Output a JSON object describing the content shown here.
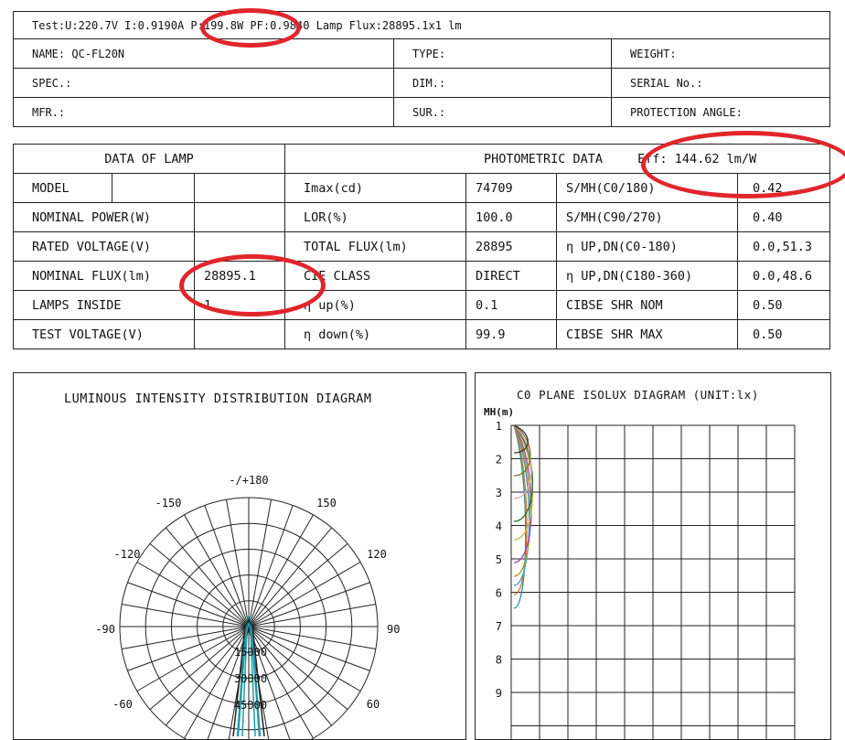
{
  "header": {
    "test_line_a": "Test:U:220.7V I:0.9190A ",
    "test_power": "P:199.8W",
    "test_line_b": " PF:0.9840  Lamp Flux:28895.1x1 lm"
  },
  "info": {
    "name": "NAME: QC-FL20N",
    "type": "TYPE:",
    "weight": "WEIGHT:",
    "spec": "SPEC.:",
    "dim": "DIM.:",
    "serial": "SERIAL No.:",
    "mfr": "MFR.:",
    "sur": "SUR.:",
    "protection": "PROTECTION ANGLE:"
  },
  "lamp_data": {
    "title": "DATA OF LAMP",
    "rows": [
      {
        "label": "MODEL",
        "value": ""
      },
      {
        "label": "NOMINAL POWER(W)",
        "value": ""
      },
      {
        "label": "RATED VOLTAGE(V)",
        "value": ""
      },
      {
        "label": "NOMINAL FLUX(lm)",
        "value": "28895.1"
      },
      {
        "label": "LAMPS INSIDE",
        "value": "1"
      },
      {
        "label": "TEST VOLTAGE(V)",
        "value": ""
      }
    ]
  },
  "photometric": {
    "title": "PHOTOMETRIC DATA",
    "efficiency": "Eff: 144.62 lm/W",
    "rows": [
      {
        "label1": "Imax(cd)",
        "value1": "74709",
        "label2": "S/MH(C0/180)",
        "value2": "0.42"
      },
      {
        "label1": "LOR(%)",
        "value1": "100.0",
        "label2": "S/MH(C90/270)",
        "value2": "0.40"
      },
      {
        "label1": "TOTAL FLUX(lm)",
        "value1": "28895",
        "label2": "η UP,DN(C0-180)",
        "value2": "0.0,51.3"
      },
      {
        "label1": "CIE CLASS",
        "value1": "DIRECT",
        "label2": "η UP,DN(C180-360)",
        "value2": "0.0,48.6"
      },
      {
        "label1": "η up(%)",
        "value1": "0.1",
        "label2": "CIBSE SHR NOM",
        "value2": "0.50"
      },
      {
        "label1": "η down(%)",
        "value1": "99.9",
        "label2": "CIBSE SHR MAX",
        "value2": "0.50"
      }
    ]
  },
  "polar_diagram": {
    "title": "LUMINOUS INTENSITY DISTRIBUTION DIAGRAM",
    "angle_labels": [
      "-/+180",
      "-150",
      "150",
      "-120",
      "120",
      "-90",
      "90",
      "-60",
      "60"
    ],
    "intensity_labels": [
      "15000",
      "30000",
      "45000"
    ]
  },
  "isolux_diagram": {
    "title": "C0 PLANE ISOLUX DIAGRAM (UNIT:lx)",
    "y_axis_label": "MH(m)",
    "y_ticks": [
      "1",
      "2",
      "3",
      "4",
      "5",
      "6",
      "7",
      "8",
      "9"
    ]
  },
  "colors": {
    "annotation": "#e0262b",
    "curve_main": "#1f9aa8",
    "curve_dark": "#222222",
    "isolux": [
      "#1a8fa0",
      "#e07020",
      "#3a9ad8",
      "#a0a020",
      "#a040c0",
      "#c0c040",
      "#2c6e2c",
      "#e0b0c0",
      "#8a6a20",
      "#333333"
    ]
  }
}
